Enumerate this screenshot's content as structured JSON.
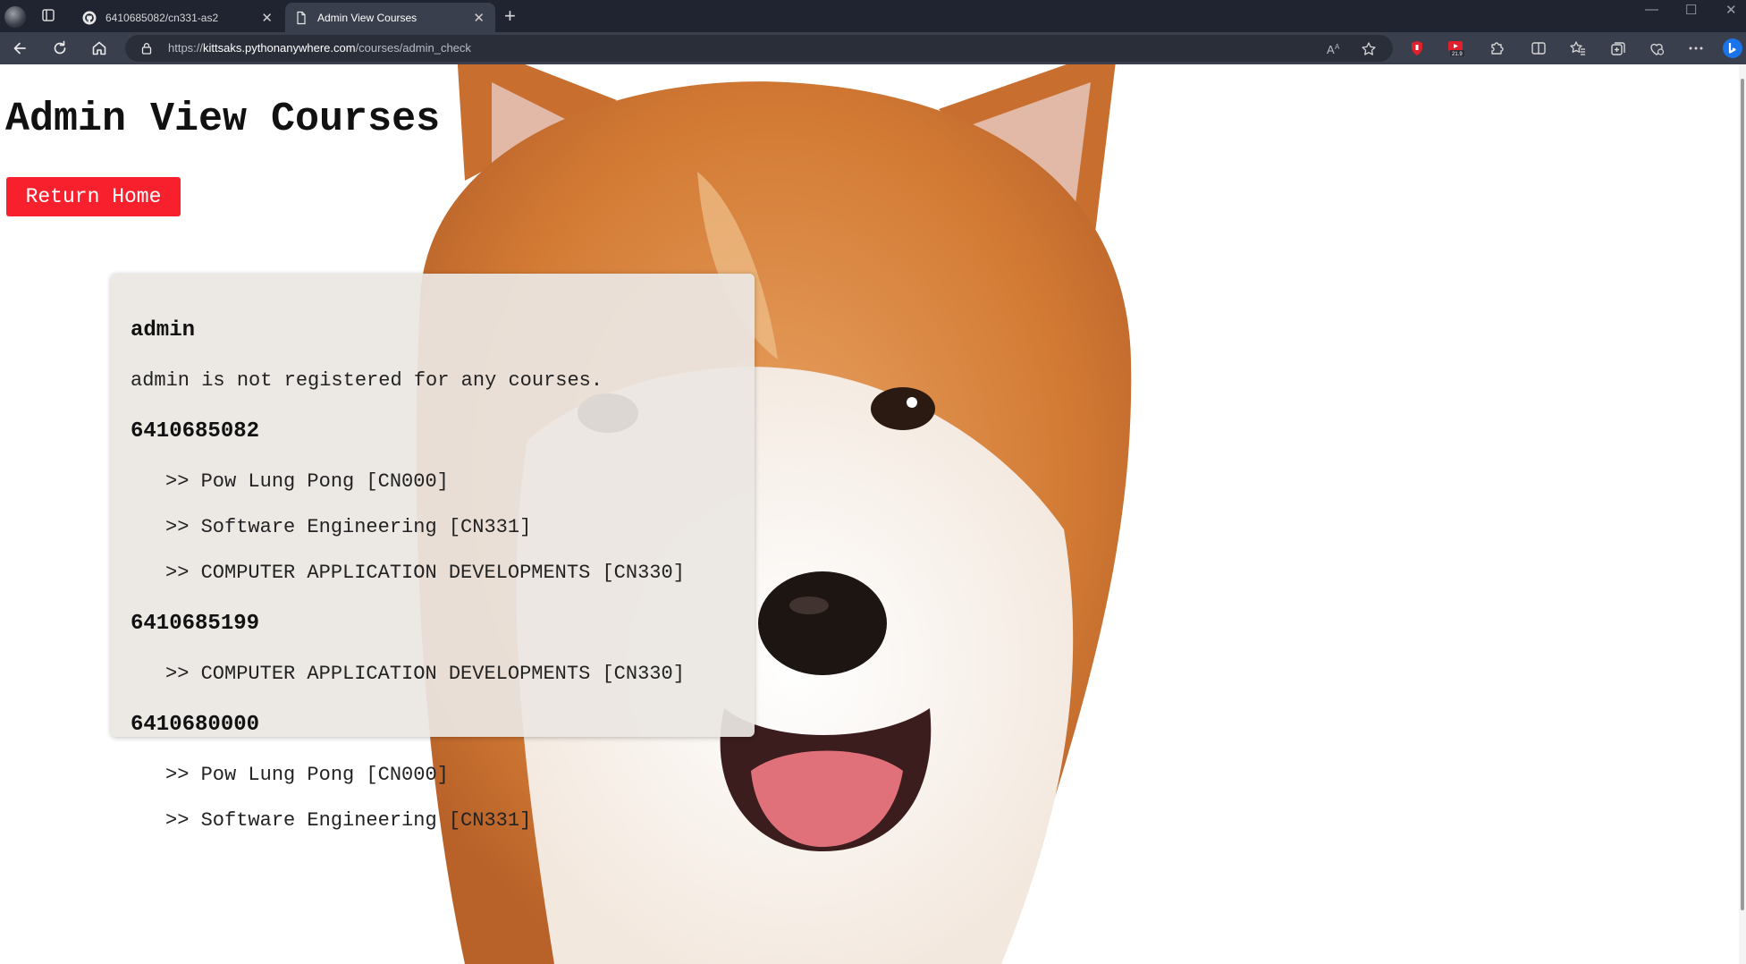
{
  "browser": {
    "tabs": [
      {
        "title": "6410685082/cn331-as2",
        "active": false
      },
      {
        "title": "Admin View Courses",
        "active": true
      }
    ],
    "url_scheme": "https://",
    "url_host": "kittsaks.pythonanywhere.com",
    "url_path": "/courses/admin_check",
    "extension_badge": "21.9"
  },
  "page": {
    "title": "Admin View Courses",
    "home_button": "Return Home",
    "users": [
      {
        "id": "admin",
        "empty_message": "admin is not registered for any courses.",
        "courses": []
      },
      {
        "id": "6410685082",
        "courses": [
          ">> Pow Lung Pong [CN000]",
          ">> Software Engineering [CN331]",
          ">> COMPUTER APPLICATION DEVELOPMENTS [CN330]"
        ]
      },
      {
        "id": "6410685199",
        "courses": [
          ">> COMPUTER APPLICATION DEVELOPMENTS [CN330]"
        ]
      },
      {
        "id": "6410680000",
        "courses": [
          ">> Pow Lung Pong [CN000]",
          ">> Software Engineering [CN331]"
        ]
      }
    ]
  },
  "colors": {
    "button_red": "#f8202c",
    "chrome_dark": "#202431",
    "toolbar": "#3a3f4d"
  }
}
